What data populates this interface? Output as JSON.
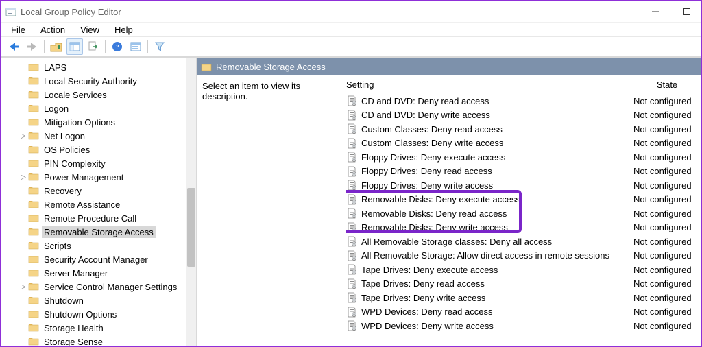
{
  "window": {
    "title": "Local Group Policy Editor"
  },
  "menu": {
    "file": "File",
    "action": "Action",
    "view": "View",
    "help": "Help"
  },
  "description_prompt": "Select an item to view its description.",
  "list_headers": {
    "setting": "Setting",
    "state": "State"
  },
  "category_title": "Removable Storage Access",
  "tree": [
    {
      "label": "LAPS",
      "expandable": false
    },
    {
      "label": "Local Security Authority",
      "expandable": false
    },
    {
      "label": "Locale Services",
      "expandable": false
    },
    {
      "label": "Logon",
      "expandable": false
    },
    {
      "label": "Mitigation Options",
      "expandable": false
    },
    {
      "label": "Net Logon",
      "expandable": true
    },
    {
      "label": "OS Policies",
      "expandable": false
    },
    {
      "label": "PIN Complexity",
      "expandable": false
    },
    {
      "label": "Power Management",
      "expandable": true
    },
    {
      "label": "Recovery",
      "expandable": false
    },
    {
      "label": "Remote Assistance",
      "expandable": false
    },
    {
      "label": "Remote Procedure Call",
      "expandable": false
    },
    {
      "label": "Removable Storage Access",
      "expandable": false,
      "selected": true
    },
    {
      "label": "Scripts",
      "expandable": false
    },
    {
      "label": "Security Account Manager",
      "expandable": false
    },
    {
      "label": "Server Manager",
      "expandable": false
    },
    {
      "label": "Service Control Manager Settings",
      "expandable": true
    },
    {
      "label": "Shutdown",
      "expandable": false
    },
    {
      "label": "Shutdown Options",
      "expandable": false
    },
    {
      "label": "Storage Health",
      "expandable": false
    },
    {
      "label": "Storage Sense",
      "expandable": false
    }
  ],
  "settings": [
    {
      "label": "CD and DVD: Deny read access",
      "state": "Not configured"
    },
    {
      "label": "CD and DVD: Deny write access",
      "state": "Not configured"
    },
    {
      "label": "Custom Classes: Deny read access",
      "state": "Not configured"
    },
    {
      "label": "Custom Classes: Deny write access",
      "state": "Not configured"
    },
    {
      "label": "Floppy Drives: Deny execute access",
      "state": "Not configured"
    },
    {
      "label": "Floppy Drives: Deny read access",
      "state": "Not configured"
    },
    {
      "label": "Floppy Drives: Deny write access",
      "state": "Not configured"
    },
    {
      "label": "Removable Disks: Deny execute access",
      "state": "Not configured",
      "hl": true
    },
    {
      "label": "Removable Disks: Deny read access",
      "state": "Not configured",
      "hl": true
    },
    {
      "label": "Removable Disks: Deny write access",
      "state": "Not configured",
      "hl": true
    },
    {
      "label": "All Removable Storage classes: Deny all access",
      "state": "Not configured"
    },
    {
      "label": "All Removable Storage: Allow direct access in remote sessions",
      "state": "Not configured"
    },
    {
      "label": "Tape Drives: Deny execute access",
      "state": "Not configured"
    },
    {
      "label": "Tape Drives: Deny read access",
      "state": "Not configured"
    },
    {
      "label": "Tape Drives: Deny write access",
      "state": "Not configured"
    },
    {
      "label": "WPD Devices: Deny read access",
      "state": "Not configured"
    },
    {
      "label": "WPD Devices: Deny write access",
      "state": "Not configured"
    }
  ],
  "highlight": {
    "start_index": 7,
    "count": 3
  }
}
